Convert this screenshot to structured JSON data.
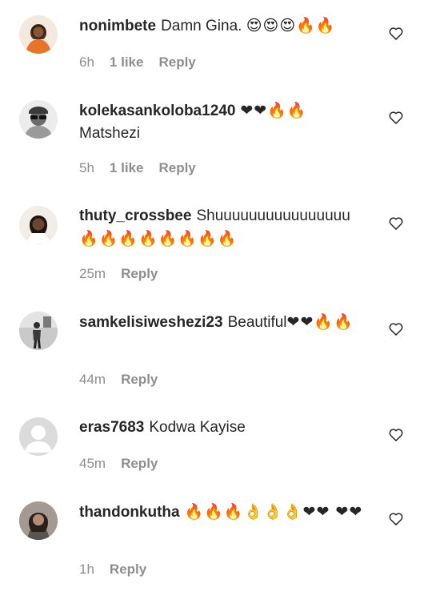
{
  "comments": [
    {
      "username": "nonimbete",
      "text": "Damn Gina. ",
      "emoji": "😍😍😍🔥🔥",
      "time": "6h",
      "likes": "1 like",
      "reply_label": "Reply",
      "avatar_icon": "avatar-photo-woman-orange",
      "avatar_color": "#e8742a"
    },
    {
      "username": "kolekasankoloba1240",
      "text": " Matshezi",
      "emoji": "❤❤🔥🔥",
      "time": "5h",
      "likes": "1 like",
      "reply_label": "Reply",
      "avatar_icon": "avatar-photo-sunglasses",
      "avatar_color": "#cfcfcf"
    },
    {
      "username": "thuty_crossbee",
      "text": "Shuuuuuuuuuuuuuuuu ",
      "emoji": "🔥🔥🔥🔥🔥🔥🔥🔥",
      "time": "25m",
      "likes": "",
      "reply_label": "Reply",
      "avatar_icon": "avatar-photo-woman-white",
      "avatar_color": "#d9cfc6"
    },
    {
      "username": "samkelisiweshezi23",
      "text": "Beautiful",
      "emoji": "❤❤🔥🔥",
      "time": "44m",
      "likes": "",
      "reply_label": "Reply",
      "avatar_icon": "avatar-photo-dark-figure",
      "avatar_color": "#5c5c5c"
    },
    {
      "username": "eras7683",
      "text": "Kodwa Kayise",
      "emoji": "",
      "time": "45m",
      "likes": "",
      "reply_label": "Reply",
      "avatar_icon": "default-avatar-icon",
      "avatar_color": "#dbdbdb"
    },
    {
      "username": "thandonkutha",
      "text": "",
      "emoji": "🔥🔥🔥👌👌👌❤❤ ❤❤",
      "time": "1h",
      "likes": "",
      "reply_label": "Reply",
      "avatar_icon": "avatar-photo-woman-gray",
      "avatar_color": "#8a7f78"
    }
  ],
  "like_icon": "heart-outline-icon"
}
